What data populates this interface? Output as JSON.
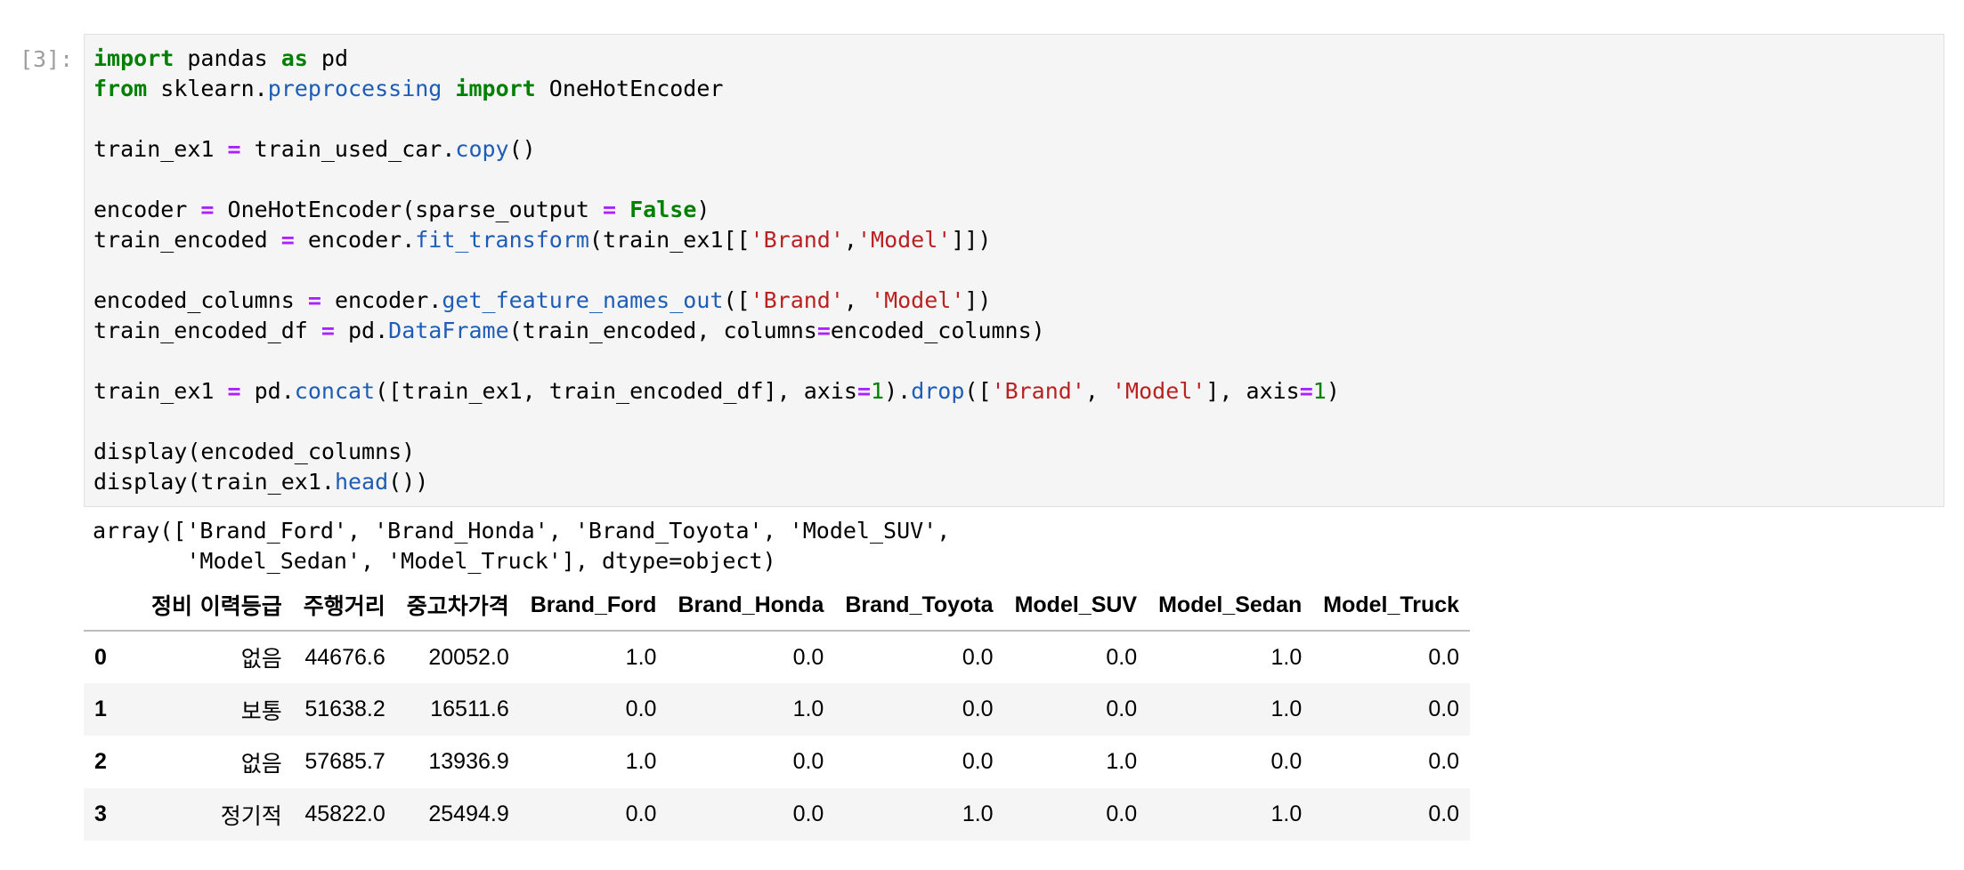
{
  "cell": {
    "prompt": "[3]:",
    "code_lines": [
      [
        {
          "t": "kw",
          "v": "import"
        },
        {
          "t": "",
          "v": " pandas "
        },
        {
          "t": "kw",
          "v": "as"
        },
        {
          "t": "",
          "v": " pd"
        }
      ],
      [
        {
          "t": "kw",
          "v": "from"
        },
        {
          "t": "",
          "v": " sklearn."
        },
        {
          "t": "fn",
          "v": "preprocessing"
        },
        {
          "t": "",
          "v": " "
        },
        {
          "t": "kw",
          "v": "import"
        },
        {
          "t": "",
          "v": " OneHotEncoder"
        }
      ],
      [],
      [
        {
          "t": "",
          "v": "train_ex1 "
        },
        {
          "t": "op",
          "v": "="
        },
        {
          "t": "",
          "v": " train_used_car."
        },
        {
          "t": "fn",
          "v": "copy"
        },
        {
          "t": "",
          "v": "()"
        }
      ],
      [],
      [
        {
          "t": "",
          "v": "encoder "
        },
        {
          "t": "op",
          "v": "="
        },
        {
          "t": "",
          "v": " OneHotEncoder(sparse_output "
        },
        {
          "t": "op",
          "v": "="
        },
        {
          "t": "",
          "v": " "
        },
        {
          "t": "kw",
          "v": "False"
        },
        {
          "t": "",
          "v": ")"
        }
      ],
      [
        {
          "t": "",
          "v": "train_encoded "
        },
        {
          "t": "op",
          "v": "="
        },
        {
          "t": "",
          "v": " encoder."
        },
        {
          "t": "fn",
          "v": "fit_transform"
        },
        {
          "t": "",
          "v": "(train_ex1[["
        },
        {
          "t": "str",
          "v": "'Brand'"
        },
        {
          "t": "",
          "v": ","
        },
        {
          "t": "str",
          "v": "'Model'"
        },
        {
          "t": "",
          "v": "]])"
        }
      ],
      [],
      [
        {
          "t": "",
          "v": "encoded_columns "
        },
        {
          "t": "op",
          "v": "="
        },
        {
          "t": "",
          "v": " encoder."
        },
        {
          "t": "fn",
          "v": "get_feature_names_out"
        },
        {
          "t": "",
          "v": "(["
        },
        {
          "t": "str",
          "v": "'Brand'"
        },
        {
          "t": "",
          "v": ", "
        },
        {
          "t": "str",
          "v": "'Model'"
        },
        {
          "t": "",
          "v": "])"
        }
      ],
      [
        {
          "t": "",
          "v": "train_encoded_df "
        },
        {
          "t": "op",
          "v": "="
        },
        {
          "t": "",
          "v": " pd."
        },
        {
          "t": "fn",
          "v": "DataFrame"
        },
        {
          "t": "",
          "v": "(train_encoded, columns"
        },
        {
          "t": "op",
          "v": "="
        },
        {
          "t": "",
          "v": "encoded_columns)"
        }
      ],
      [],
      [
        {
          "t": "",
          "v": "train_ex1 "
        },
        {
          "t": "op",
          "v": "="
        },
        {
          "t": "",
          "v": " pd."
        },
        {
          "t": "fn",
          "v": "concat"
        },
        {
          "t": "",
          "v": "([train_ex1, train_encoded_df], axis"
        },
        {
          "t": "op",
          "v": "="
        },
        {
          "t": "num",
          "v": "1"
        },
        {
          "t": "",
          "v": ")."
        },
        {
          "t": "fn",
          "v": "drop"
        },
        {
          "t": "",
          "v": "(["
        },
        {
          "t": "str",
          "v": "'Brand'"
        },
        {
          "t": "",
          "v": ", "
        },
        {
          "t": "str",
          "v": "'Model'"
        },
        {
          "t": "",
          "v": "], axis"
        },
        {
          "t": "op",
          "v": "="
        },
        {
          "t": "num",
          "v": "1"
        },
        {
          "t": "",
          "v": ")"
        }
      ],
      [],
      [
        {
          "t": "",
          "v": "display(encoded_columns)"
        }
      ],
      [
        {
          "t": "",
          "v": "display(train_ex1."
        },
        {
          "t": "fn",
          "v": "head"
        },
        {
          "t": "",
          "v": "())"
        }
      ]
    ]
  },
  "output": {
    "array_lines": [
      "array(['Brand_Ford', 'Brand_Honda', 'Brand_Toyota', 'Model_SUV',",
      "       'Model_Sedan', 'Model_Truck'], dtype=object)"
    ],
    "table": {
      "columns": [
        "정비 이력등급",
        "주행거리",
        "중고차가격",
        "Brand_Ford",
        "Brand_Honda",
        "Brand_Toyota",
        "Model_SUV",
        "Model_Sedan",
        "Model_Truck"
      ],
      "rows": [
        {
          "index": "0",
          "cells": [
            "없음",
            "44676.6",
            "20052.0",
            "1.0",
            "0.0",
            "0.0",
            "0.0",
            "1.0",
            "0.0"
          ]
        },
        {
          "index": "1",
          "cells": [
            "보통",
            "51638.2",
            "16511.6",
            "0.0",
            "1.0",
            "0.0",
            "0.0",
            "1.0",
            "0.0"
          ]
        },
        {
          "index": "2",
          "cells": [
            "없음",
            "57685.7",
            "13936.9",
            "1.0",
            "0.0",
            "0.0",
            "1.0",
            "0.0",
            "0.0"
          ]
        },
        {
          "index": "3",
          "cells": [
            "정기적",
            "45822.0",
            "25494.9",
            "0.0",
            "0.0",
            "1.0",
            "0.0",
            "1.0",
            "0.0"
          ]
        }
      ]
    }
  }
}
